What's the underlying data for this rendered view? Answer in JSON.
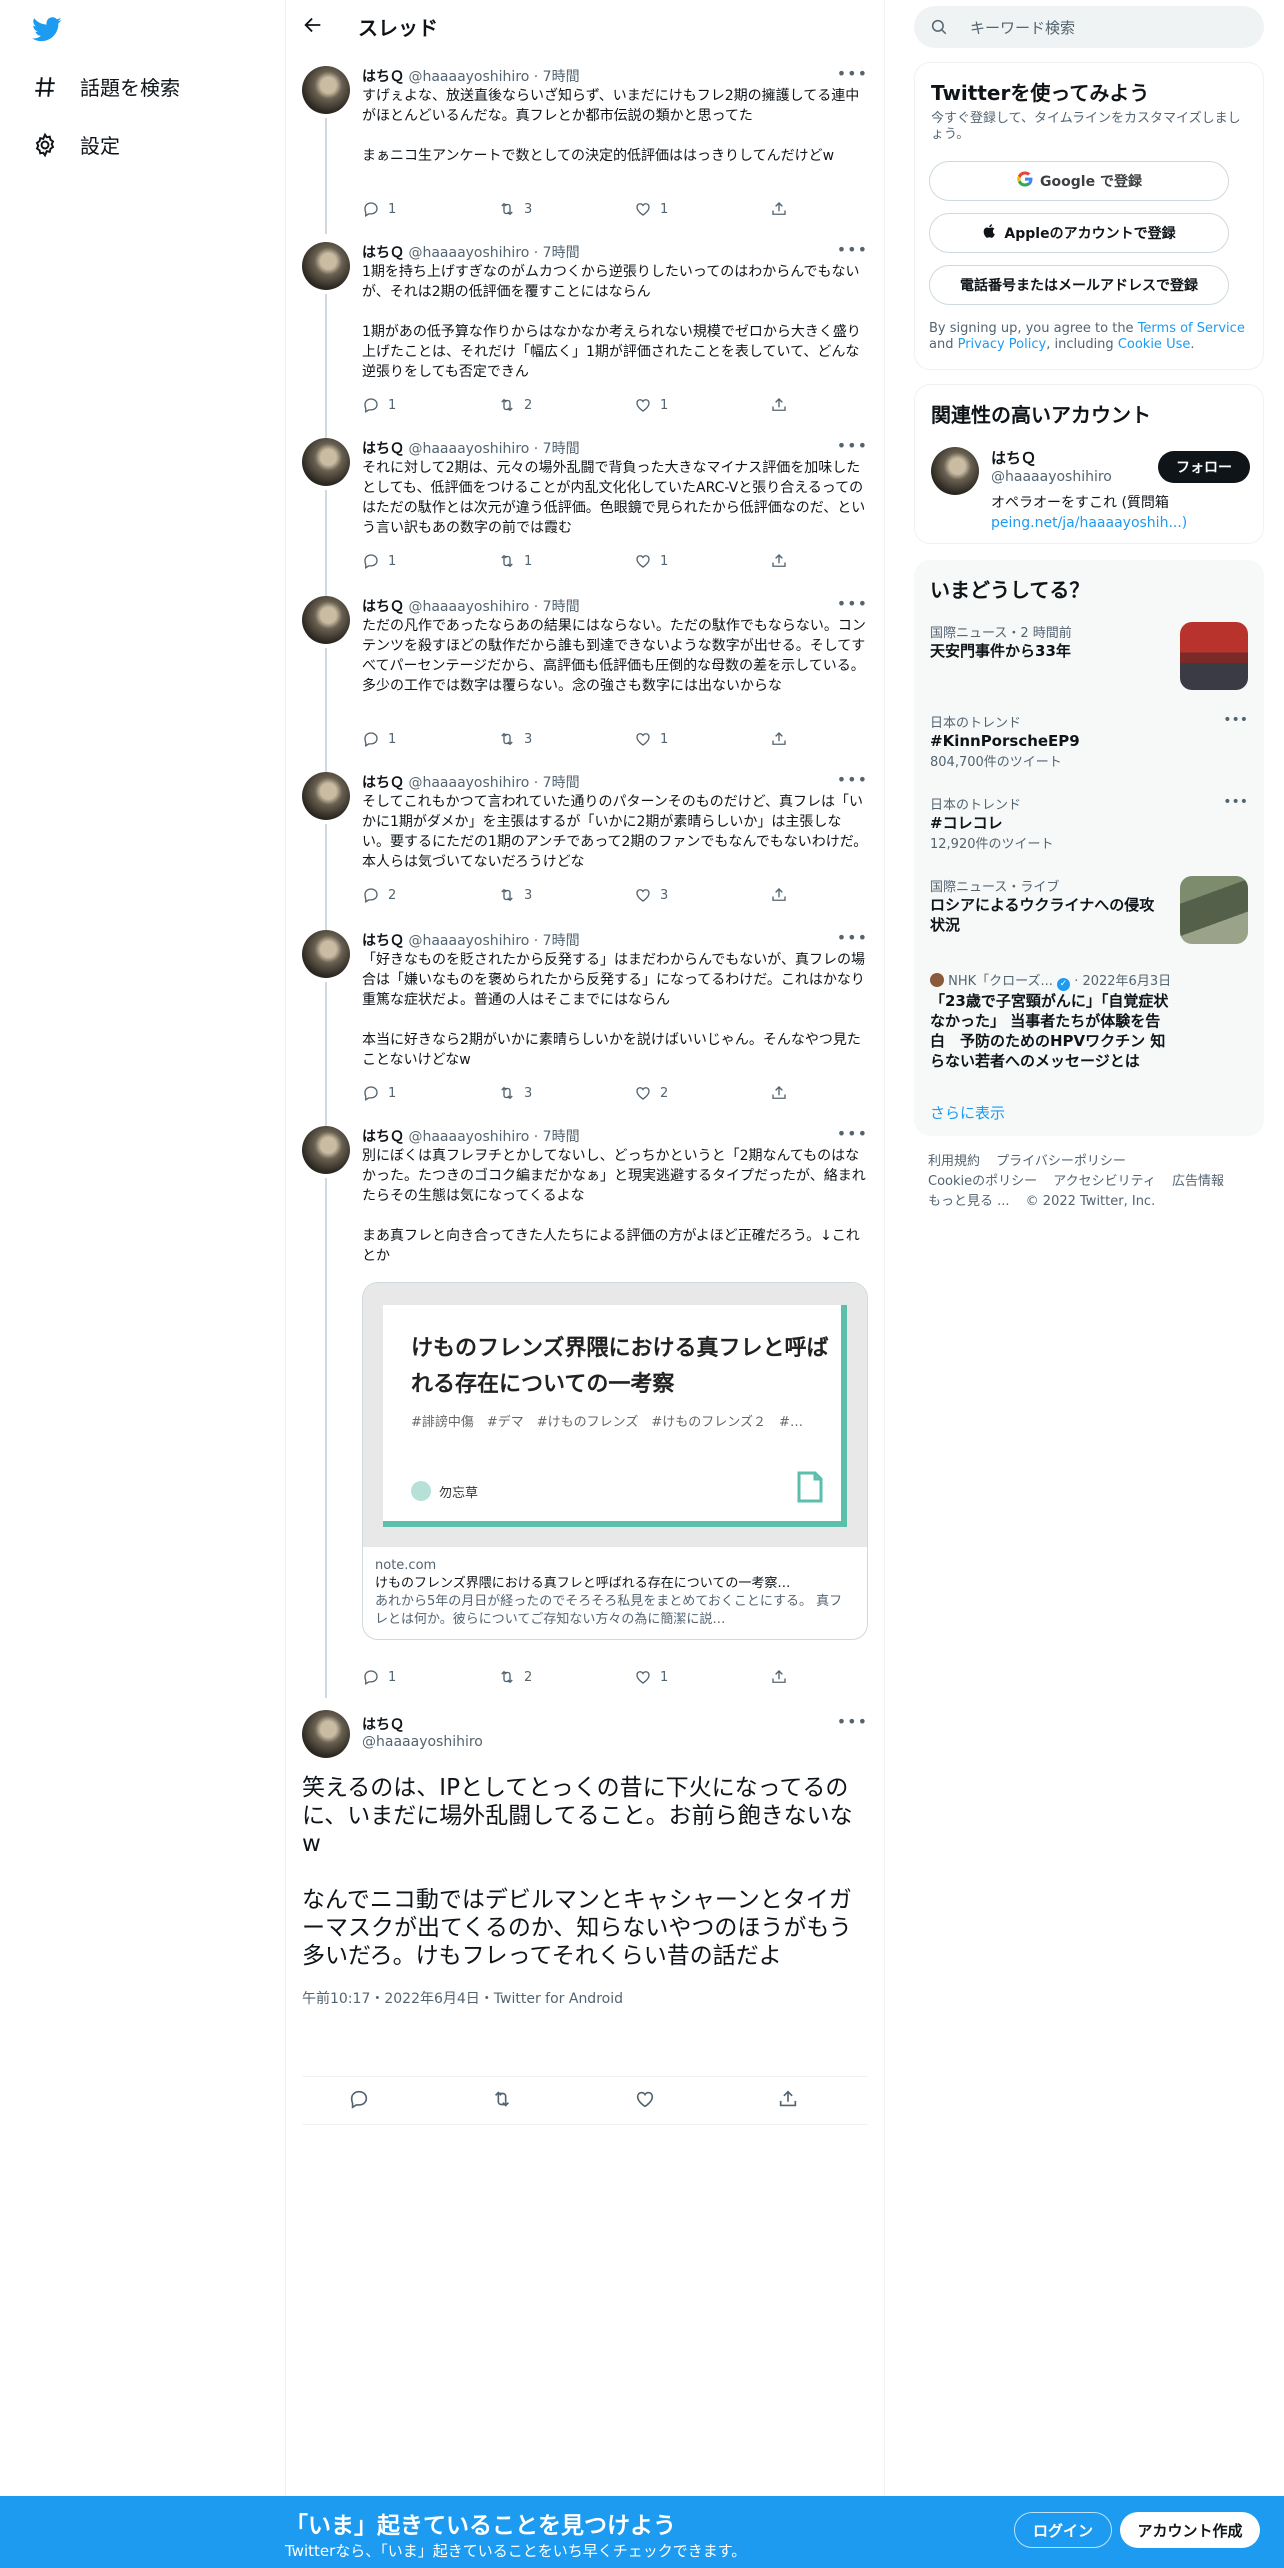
{
  "nav": {
    "explore_label": "話題を検索",
    "settings_label": "設定"
  },
  "header": {
    "title": "スレッド"
  },
  "thread": [
    {
      "name": "はちＱ",
      "handle": "@haaaayoshihiro",
      "time": "· 7時間",
      "text": "すげぇよな、放送直後ならいざ知らず、いまだにけもフレ2期の擁護してる連中がほとんどいるんだな。真フレとか都市伝説の類かと思ってた\n\nまぁニコ生アンケートで数としての決定的低評価ははっきりしてんだけどw",
      "replies": "1",
      "retweets": "3",
      "likes": "1"
    },
    {
      "name": "はちＱ",
      "handle": "@haaaayoshihiro",
      "time": "· 7時間",
      "text": "1期を持ち上げすぎなのがムカつくから逆張りしたいってのはわからんでもないが、それは2期の低評価を覆すことにはならん\n\n1期があの低予算な作りからはなかなか考えられない規模でゼロから大きく盛り上げたことは、それだけ「幅広く」1期が評価されたことを表していて、どんな逆張りをしても否定できん",
      "replies": "1",
      "retweets": "2",
      "likes": "1"
    },
    {
      "name": "はちＱ",
      "handle": "@haaaayoshihiro",
      "time": "· 7時間",
      "text": "それに対して2期は、元々の場外乱闘で背負った大きなマイナス評価を加味したとしても、低評価をつけることが内乱文化化していたARC-Vと張り合えるってのはただの駄作とは次元が違う低評価。色眼鏡で見られたから低評価なのだ、という言い訳もあの数字の前では霞む",
      "replies": "1",
      "retweets": "1",
      "likes": "1"
    },
    {
      "name": "はちＱ",
      "handle": "@haaaayoshihiro",
      "time": "· 7時間",
      "text": "ただの凡作であったならあの結果にはならない。ただの駄作でもならない。コンテンツを殺すほどの駄作だから誰も到達できないような数字が出せる。そしてすべてパーセンテージだから、高評価も低評価も圧倒的な母数の差を示している。多少の工作では数字は覆らない。念の強さも数字には出ないからな",
      "replies": "1",
      "retweets": "3",
      "likes": "1"
    },
    {
      "name": "はちＱ",
      "handle": "@haaaayoshihiro",
      "time": "· 7時間",
      "text": "そしてこれもかつて言われていた通りのパターンそのものだけど、真フレは「いかに1期がダメか」を主張はするが「いかに2期が素晴らしいか」は主張しない。要するにただの1期のアンチであって2期のファンでもなんでもないわけだ。本人らは気づいてないだろうけどな",
      "replies": "2",
      "retweets": "3",
      "likes": "3"
    },
    {
      "name": "はちＱ",
      "handle": "@haaaayoshihiro",
      "time": "· 7時間",
      "text": "「好きなものを貶されたから反発する」はまだわからんでもないが、真フレの場合は「嫌いなものを褒められたから反発する」になってるわけだ。これはかなり重篤な症状だよ。普通の人はそこまでにはならん\n\n本当に好きなら2期がいかに素晴らしいかを説けばいいじゃん。そんなやつ見たことないけどなw",
      "replies": "1",
      "retweets": "3",
      "likes": "2"
    },
    {
      "name": "はちＱ",
      "handle": "@haaaayoshihiro",
      "time": "· 7時間",
      "text": "別にぼくは真フレヲチとかしてないし、どっちかというと「2期なんてものはなかった。たつきのゴコク編まだかなぁ」と現実逃避するタイプだったが、絡まれたらその生態は気になってくるよな\n\nまあ真フレと向き合ってきた人たちによる評価の方がよほど正確だろう。↓これとか",
      "replies": "1",
      "retweets": "2",
      "likes": "1",
      "card": {
        "image_title": "けものフレンズ界隈における真フレと呼ばれる存在についての一考察",
        "image_tags": "#誹謗中傷　#デマ　#けものフレンズ　#けものフレンズ２　#…",
        "image_author": "勿忘草",
        "domain": "note.com",
        "title": "けものフレンズ界隈における真フレと呼ばれる存在についての一考察…",
        "desc": "あれから5年の月日が経ったのでそろそろ私見をまとめておくことにする。 真フレとは何か。彼らについてご存知ない方々の為に簡潔に説…"
      }
    }
  ],
  "focus": {
    "name": "はちＱ",
    "handle": "@haaaayoshihiro",
    "text": "笑えるのは、IPとしてとっくの昔に下火になってるのに、いまだに場外乱闘してること。お前ら飽きないなw\n\nなんでニコ動ではデビルマンとキャシャーンとタイガーマスクが出てくるのか、知らないやつのほうがもう多いだろ。けもフレってそれくらい昔の話だよ",
    "meta": "午前10:17・2022年6月4日・Twitter for Android"
  },
  "right": {
    "search_placeholder": "キーワード検索",
    "signup": {
      "title": "Twitterを使ってみよう",
      "subtitle": "今すぐ登録して、タイムラインをカスタマイズしましょう。",
      "google": "Google で登録",
      "apple": "Appleのアカウントで登録",
      "phone": "電話番号またはメールアドレスで登録",
      "terms_pre": "By signing up, you agree to the ",
      "terms_link": "Terms of Service",
      "terms_and": " and ",
      "privacy_link": "Privacy Policy",
      "terms_incl": ", including ",
      "cookie_link": "Cookie Use",
      "terms_end": "."
    },
    "related": {
      "title": "関連性の高いアカウント",
      "name": "はちＱ",
      "handle": "@haaaayoshihiro",
      "follow": "フォロー",
      "bio": "オペラオーをすこれ (質問箱",
      "bio_link": "peing.net/ja/haaaayoshih...)"
    },
    "trends": {
      "title": "いまどうしてる？",
      "items": [
        {
          "meta": "国際ニュース・2 時間前",
          "title": "天安門事件から33年",
          "count": ""
        },
        {
          "meta": "日本のトレンド",
          "title": "#KinnPorscheEP9",
          "count": "804,700件のツイート"
        },
        {
          "meta": "日本のトレンド",
          "title": "#コレコレ",
          "count": "12,920件のツイート"
        },
        {
          "meta": "国際ニュース・ライブ",
          "title": "ロシアによるウクライナへの侵攻状況",
          "count": ""
        },
        {
          "meta": "NHK「クローズ...",
          "date": "· 2022年6月3日",
          "title": "「23歳で子宮頸がんに」「自覚症状なかった」 当事者たちが体験を告白　予防のためのHPVワクチン 知らない若者へのメッセージとは",
          "count": ""
        }
      ],
      "show_more": "さらに表示"
    },
    "footer": {
      "l1": "利用規約",
      "l2": "プライバシーポリシー",
      "l3": "Cookieのポリシー",
      "l4": "アクセシビリティ",
      "l5": "広告情報",
      "l6": "もっと見る ...",
      "l7": "© 2022 Twitter, Inc."
    }
  },
  "bottombar": {
    "title": "「いま」起きていることを見つけよう",
    "subtitle": "Twitterなら、「いま」起きていることをいち早くチェックできます。",
    "login": "ログイン",
    "signup": "アカウント作成"
  },
  "colors": {
    "accent": "#1d9bf0",
    "text": "#0f1419",
    "muted": "#536471",
    "card_accent": "#5cbfac"
  }
}
